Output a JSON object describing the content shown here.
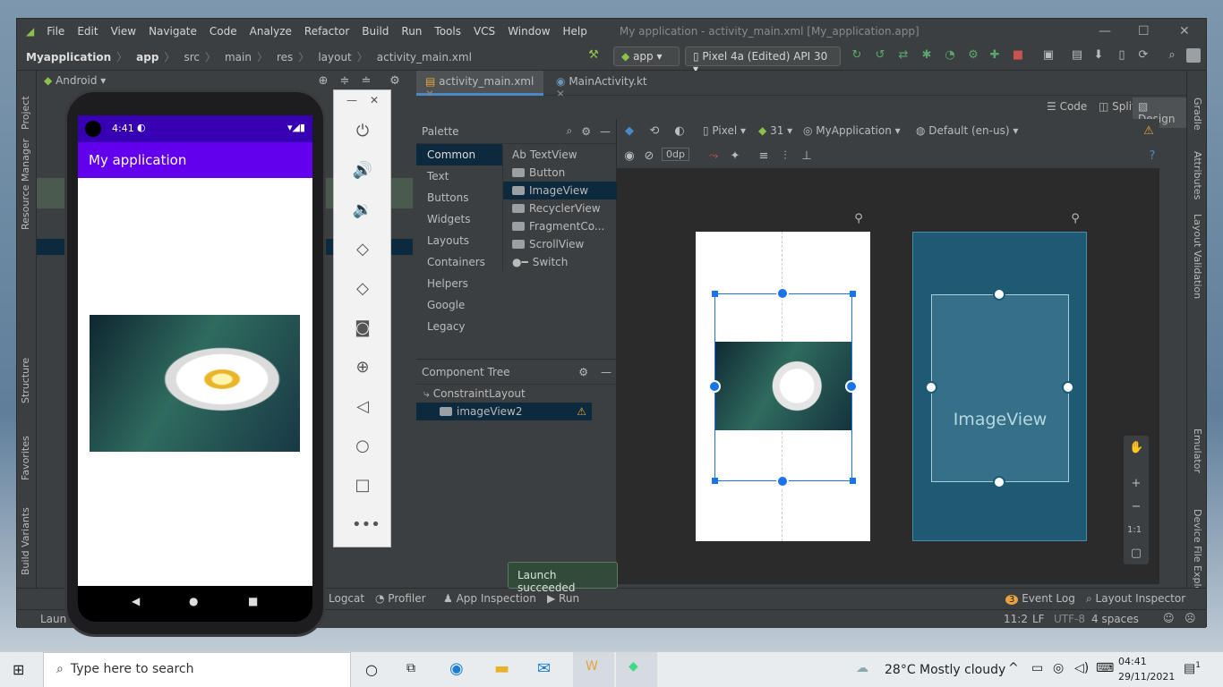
{
  "window": {
    "title": "My application - activity_main.xml [My_application.app]"
  },
  "menu": [
    "File",
    "Edit",
    "View",
    "Navigate",
    "Code",
    "Analyze",
    "Refactor",
    "Build",
    "Run",
    "Tools",
    "VCS",
    "Window",
    "Help"
  ],
  "breadcrumb": [
    "Myapplication",
    "app",
    "src",
    "main",
    "res",
    "layout",
    "activity_main.xml"
  ],
  "run_config": "app",
  "device_selector": "Pixel 4a (Edited) API 30",
  "project_view": "Android",
  "tabs": [
    "activity_main.xml",
    "MainActivity.kt"
  ],
  "view_modes": {
    "code": "Code",
    "split": "Split",
    "design": "Design"
  },
  "palette": {
    "title": "Palette",
    "categories": [
      "Common",
      "Text",
      "Buttons",
      "Widgets",
      "Layouts",
      "Containers",
      "Helpers",
      "Google",
      "Legacy"
    ],
    "items": [
      "TextView",
      "Button",
      "ImageView",
      "RecyclerView",
      "FragmentCo...",
      "ScrollView",
      "Switch"
    ],
    "textview_prefix": "Ab"
  },
  "component_tree": {
    "title": "Component Tree",
    "root": "ConstraintLayout",
    "child": "imageView2"
  },
  "design_toolbar": {
    "device": "Pixel",
    "api": "31",
    "theme": "MyApplication",
    "locale": "Default (en-us)",
    "margin": "0dp"
  },
  "blueprint": {
    "label": "ImageView"
  },
  "zoom": {
    "fit": "1:1"
  },
  "left_tools": [
    "Project",
    "Resource Manager",
    "Structure",
    "Favorites",
    "Build Variants"
  ],
  "right_tools": [
    "Gradle",
    "Attributes",
    "Layout Validation",
    "Emulator",
    "Device File Explorer"
  ],
  "bottom_tools": [
    "Logcat",
    "Profiler",
    "App Inspection",
    "Run",
    "Event Log",
    "Layout Inspector"
  ],
  "event_log_count": "3",
  "status": {
    "left": "Laun",
    "pos": "11:2",
    "lf": "LF",
    "enc": "UTF-8",
    "indent": "4 spaces"
  },
  "toast": "Launch succeeded",
  "phone": {
    "time": "4:41",
    "app_title": "My application"
  },
  "taskbar": {
    "search": "Type here to search",
    "weather": "28°C  Mostly cloudy",
    "time": "04:41",
    "date": "29/11/2021",
    "notif": "1"
  },
  "colors": {
    "accent": "#6200ee",
    "status": "#3700b3",
    "blueprint": "#1f5a73",
    "selection": "#1a73e8"
  }
}
